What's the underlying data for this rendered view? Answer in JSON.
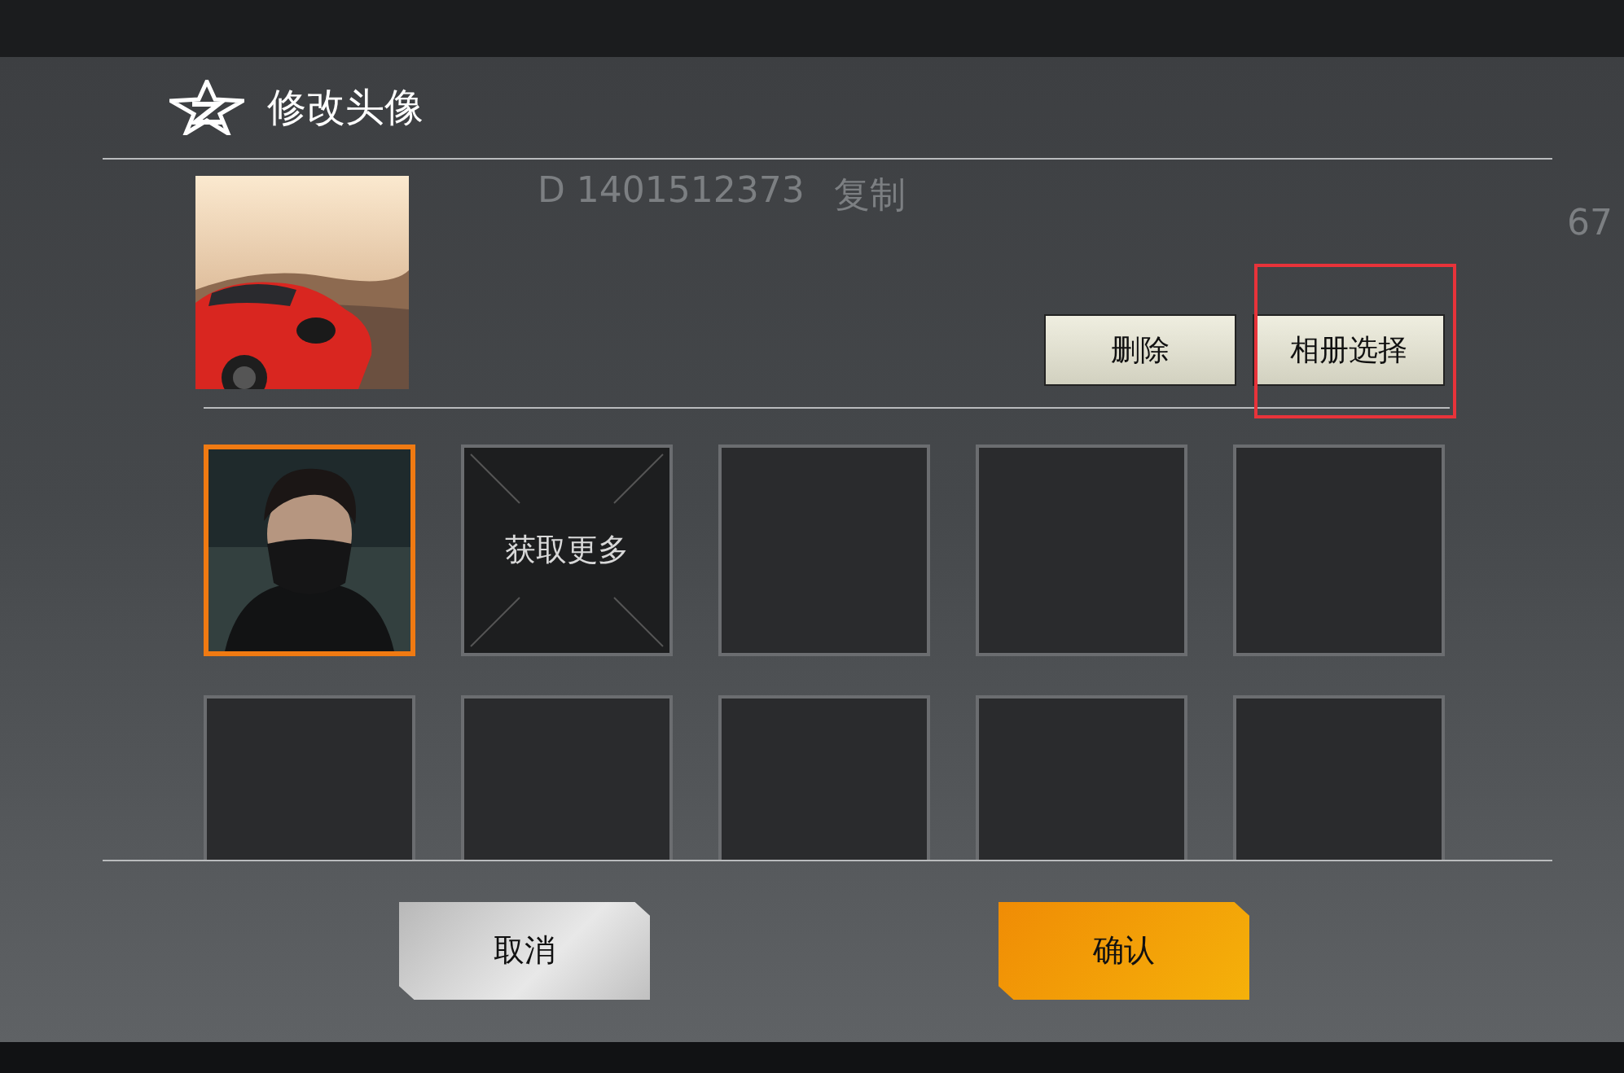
{
  "backdrop": {
    "texts": [
      "D 1401512373",
      "复制",
      "67"
    ]
  },
  "dialog": {
    "title": "修改头像",
    "actions": [
      {
        "label": "删除",
        "highlighted": false
      },
      {
        "label": "相册选择",
        "highlighted": true
      }
    ],
    "avatars": [
      {
        "kind": "portrait",
        "selected": true
      },
      {
        "kind": "more",
        "label": "获取更多",
        "selected": false
      },
      {
        "kind": "empty",
        "selected": false
      },
      {
        "kind": "empty",
        "selected": false
      },
      {
        "kind": "empty",
        "selected": false
      },
      {
        "kind": "empty",
        "selected": false
      },
      {
        "kind": "empty",
        "selected": false
      },
      {
        "kind": "empty",
        "selected": false
      },
      {
        "kind": "empty",
        "selected": false
      },
      {
        "kind": "empty",
        "selected": false
      }
    ],
    "buttons": [
      {
        "label": "取消",
        "kind": "secondary"
      },
      {
        "label": "确认",
        "kind": "primary"
      }
    ]
  }
}
